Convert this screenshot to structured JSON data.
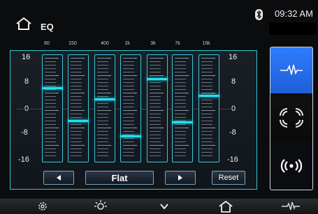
{
  "header": {
    "title": "EQ",
    "time": "09:32 AM"
  },
  "eq": {
    "y_labels": [
      "16",
      "8",
      "0",
      "-8",
      "-16"
    ],
    "bands": [
      {
        "freq": "60",
        "gain": 6.5
      },
      {
        "freq": "150",
        "gain": -4
      },
      {
        "freq": "400",
        "gain": 3
      },
      {
        "freq": "1k",
        "gain": -9
      },
      {
        "freq": "3k",
        "gain": 9.5
      },
      {
        "freq": "7k",
        "gain": -4.5
      },
      {
        "freq": "15k",
        "gain": 4
      }
    ],
    "preset": "Flat",
    "reset_label": "Reset",
    "range": [
      -16,
      16
    ]
  },
  "sidebar": {
    "items": [
      {
        "icon": "eq-wave-icon",
        "active": true
      },
      {
        "icon": "surround-icon",
        "active": false
      },
      {
        "icon": "broadcast-icon",
        "active": false
      }
    ]
  },
  "bottom_nav": [
    "settings-gear-icon",
    "brightness-icon",
    "chevron-down-icon",
    "home-icon",
    "eq-wave-icon"
  ],
  "colors": {
    "accent": "#1ee3f2",
    "border": "#2fc7d6",
    "active_blue": "#2f7cff"
  }
}
